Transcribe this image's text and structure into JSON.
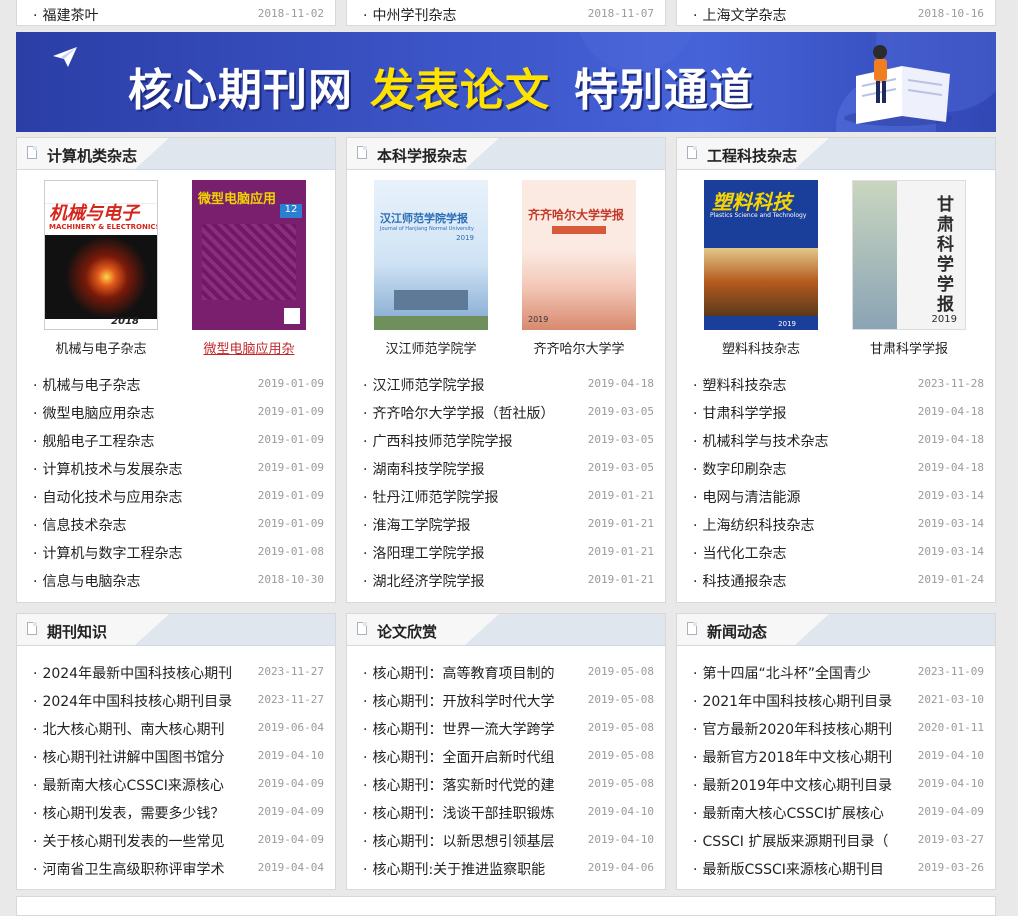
{
  "top_rows": [
    {
      "title": "福建茶叶",
      "date": "2018-11-02"
    },
    {
      "title": "中州学刊杂志",
      "date": "2018-11-07"
    },
    {
      "title": "上海文学杂志",
      "date": "2018-10-16"
    }
  ],
  "banner": {
    "part1": "核心期刊网",
    "part2": "发表论文",
    "part3": "特别通道",
    "colors": {
      "white": "#ffffff",
      "yellow": "#ffe200"
    },
    "icons": [
      "paper-plane-icon",
      "book-reader-icon"
    ]
  },
  "sections": [
    {
      "title": "计算机类杂志",
      "covers": [
        {
          "caption": "机械与电子杂志",
          "highlight": false
        },
        {
          "caption": "微型电脑应用杂",
          "highlight": true
        }
      ],
      "items": [
        [
          "机械与电子杂志",
          "2019-01-09"
        ],
        [
          "微型电脑应用杂志",
          "2019-01-09"
        ],
        [
          "舰船电子工程杂志",
          "2019-01-09"
        ],
        [
          "计算机技术与发展杂志",
          "2019-01-09"
        ],
        [
          "自动化技术与应用杂志",
          "2019-01-09"
        ],
        [
          "信息技术杂志",
          "2019-01-09"
        ],
        [
          "计算机与数字工程杂志",
          "2019-01-08"
        ],
        [
          "信息与电脑杂志",
          "2018-10-30"
        ]
      ]
    },
    {
      "title": "本科学报杂志",
      "covers": [
        {
          "caption": "汉江师范学院学",
          "highlight": false
        },
        {
          "caption": "齐齐哈尔大学学",
          "highlight": false
        }
      ],
      "items": [
        [
          "汉江师范学院学报",
          "2019-04-18"
        ],
        [
          "齐齐哈尔大学学报（哲社版）",
          "2019-03-05"
        ],
        [
          "广西科技师范学院学报",
          "2019-03-05"
        ],
        [
          "湖南科技学院学报",
          "2019-03-05"
        ],
        [
          "牡丹江师范学院学报",
          "2019-01-21"
        ],
        [
          "淮海工学院学报",
          "2019-01-21"
        ],
        [
          "洛阳理工学院学报",
          "2019-01-21"
        ],
        [
          "湖北经济学院学报",
          "2019-01-21"
        ]
      ]
    },
    {
      "title": "工程科技杂志",
      "covers": [
        {
          "caption": "塑料科技杂志",
          "highlight": false
        },
        {
          "caption": "甘肃科学学报",
          "highlight": false
        }
      ],
      "items": [
        [
          "塑料科技杂志",
          "2023-11-28"
        ],
        [
          "甘肃科学学报",
          "2019-04-18"
        ],
        [
          "机械科学与技术杂志",
          "2019-04-18"
        ],
        [
          "数字印刷杂志",
          "2019-04-18"
        ],
        [
          "电网与清洁能源",
          "2019-03-14"
        ],
        [
          "上海纺织科技杂志",
          "2019-03-14"
        ],
        [
          "当代化工杂志",
          "2019-03-14"
        ],
        [
          "科技通报杂志",
          "2019-01-24"
        ]
      ]
    },
    {
      "title": "期刊知识",
      "items": [
        [
          "2024年最新中国科技核心期刊",
          "2023-11-27"
        ],
        [
          "2024年中国科技核心期刊目录",
          "2023-11-27"
        ],
        [
          "北大核心期刊、南大核心期刊",
          "2019-06-04"
        ],
        [
          "核心期刊社讲解中国图书馆分",
          "2019-04-10"
        ],
        [
          "最新南大核心CSSCI来源核心",
          "2019-04-09"
        ],
        [
          "核心期刊发表，需要多少钱？",
          "2019-04-09"
        ],
        [
          "关于核心期刊发表的一些常见",
          "2019-04-09"
        ],
        [
          "河南省卫生高级职称评审学术",
          "2019-04-04"
        ]
      ]
    },
    {
      "title": "论文欣赏",
      "items": [
        [
          "核心期刊：高等教育项目制的",
          "2019-05-08"
        ],
        [
          "核心期刊：开放科学时代大学",
          "2019-05-08"
        ],
        [
          "核心期刊：世界一流大学跨学",
          "2019-05-08"
        ],
        [
          "核心期刊：全面开启新时代组",
          "2019-05-08"
        ],
        [
          "核心期刊：落实新时代党的建",
          "2019-05-08"
        ],
        [
          "核心期刊：浅谈干部挂职锻炼",
          "2019-04-10"
        ],
        [
          "核心期刊：以新思想引领基层",
          "2019-04-10"
        ],
        [
          "核心期刊:关于推进监察职能",
          "2019-04-06"
        ]
      ]
    },
    {
      "title": "新闻动态",
      "items": [
        [
          "第十四届“北斗杯”全国青少",
          "2023-11-09"
        ],
        [
          "2021年中国科技核心期刊目录",
          "2021-03-10"
        ],
        [
          "官方最新2020年科技核心期刊",
          "2020-01-11"
        ],
        [
          "最新官方2018年中文核心期刊",
          "2019-04-10"
        ],
        [
          "最新2019年中文核心期刊目录",
          "2019-04-10"
        ],
        [
          "最新南大核心CSSCI扩展核心",
          "2019-04-09"
        ],
        [
          "CSSCI 扩展版来源期刊目录（",
          "2019-03-27"
        ],
        [
          "最新版CSSCI来源核心期刊目",
          "2019-03-26"
        ]
      ]
    }
  ],
  "cover_art": [
    {
      "title": "机械与电子",
      "subtitle": "MACHINERY & ELECTRONICS",
      "year": "2018",
      "bg": "#ffffff",
      "accent": "#d4261c"
    },
    {
      "title": "微型电脑应用",
      "subtitle": "",
      "year": "12",
      "bg": "#7a1f6e",
      "accent": "#f1d300"
    },
    {
      "title": "汉江师范学院学报",
      "subtitle": "Journal of Hanjiang Normal University",
      "year": "2019",
      "bg": "#cfe3f5",
      "accent": "#2a6db5"
    },
    {
      "title": "齐齐哈尔大学学报",
      "subtitle": "",
      "year": "2019",
      "bg": "#fbeae2",
      "accent": "#c23a2a"
    },
    {
      "title": "塑料科技",
      "subtitle": "Plastics Science and Technology",
      "year": "2019",
      "bg": "#1a3f9b",
      "accent": "#f6d400"
    },
    {
      "title": "甘肃科学学报",
      "subtitle": "",
      "year": "2019",
      "bg": "#f4f4f4",
      "accent": "#2d2d2d"
    }
  ]
}
